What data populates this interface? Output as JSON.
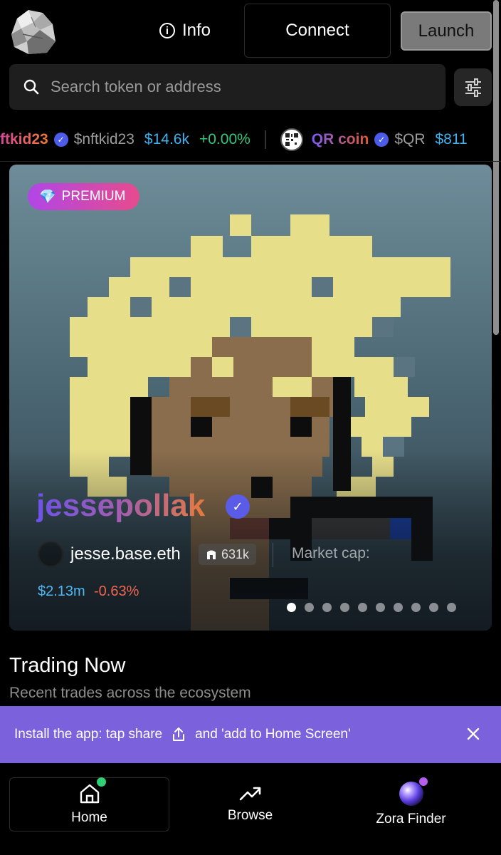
{
  "header": {
    "info_label": "Info",
    "connect_label": "Connect",
    "launch_label": "Launch"
  },
  "search": {
    "placeholder": "Search token or address"
  },
  "ticker": {
    "items": [
      {
        "name": "ftkid23",
        "symbol": "$nftkid23",
        "price": "$14.6k",
        "change": "+0.00%"
      },
      {
        "name": "QR coin",
        "symbol": "$QR",
        "price": "$811"
      }
    ]
  },
  "featured": {
    "badge": "PREMIUM",
    "coin_name": "jessepollak",
    "creator": "jesse.base.eth",
    "holders": "631k",
    "market_cap_label": "Market cap:",
    "market_cap_value": "$2.13m",
    "market_cap_change": "-0.63%",
    "page_count": 10,
    "active_page": 1
  },
  "trading": {
    "title": "Trading Now",
    "subtitle": "Recent trades across the ecosystem"
  },
  "install_banner": {
    "text_before": "Install the app: tap share",
    "text_after": "and 'add to Home Screen'"
  },
  "nav": {
    "items": [
      {
        "label": "Home",
        "icon": "home-icon"
      },
      {
        "label": "Browse",
        "icon": "trending-up-icon"
      },
      {
        "label": "Zora Finder",
        "icon": "orb-icon"
      }
    ]
  },
  "colors": {
    "accent_purple": "#7b62dc",
    "price_blue": "#3fb4f1",
    "gain_green": "#34c77b",
    "loss_red": "#f06650"
  }
}
